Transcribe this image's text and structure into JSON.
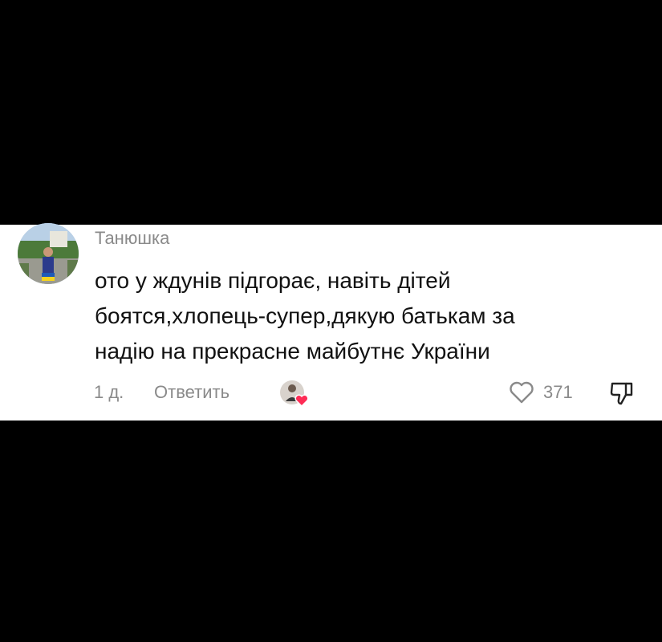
{
  "comment": {
    "author": "Танюшка",
    "text_lines": [
      "ото у ждунів підгорає, навіть дітей",
      "боятся,хлопець-супер,дякую батькам за",
      "надію на прекрасне майбутнє України"
    ],
    "time_ago": "1 д.",
    "reply_label": "Ответить",
    "like_count": "371",
    "liked_by_creator": true
  },
  "colors": {
    "background": "#000000",
    "card": "#ffffff",
    "secondary_text": "#8a8a8a",
    "heart_badge": "#fe2c55"
  },
  "icons": {
    "like": "heart-outline-icon",
    "dislike": "thumbs-down-icon",
    "creator_badge": "heart-badge-icon"
  }
}
